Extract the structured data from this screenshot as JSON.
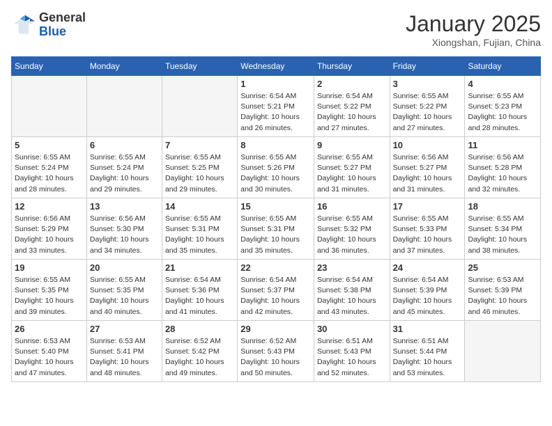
{
  "header": {
    "logo_general": "General",
    "logo_blue": "Blue",
    "month_title": "January 2025",
    "subtitle": "Xiongshan, Fujian, China"
  },
  "weekdays": [
    "Sunday",
    "Monday",
    "Tuesday",
    "Wednesday",
    "Thursday",
    "Friday",
    "Saturday"
  ],
  "weeks": [
    [
      {
        "day": "",
        "sunrise": "",
        "sunset": "",
        "daylight": "",
        "empty": true
      },
      {
        "day": "",
        "sunrise": "",
        "sunset": "",
        "daylight": "",
        "empty": true
      },
      {
        "day": "",
        "sunrise": "",
        "sunset": "",
        "daylight": "",
        "empty": true
      },
      {
        "day": "1",
        "sunrise": "Sunrise: 6:54 AM",
        "sunset": "Sunset: 5:21 PM",
        "daylight": "Daylight: 10 hours and 26 minutes."
      },
      {
        "day": "2",
        "sunrise": "Sunrise: 6:54 AM",
        "sunset": "Sunset: 5:22 PM",
        "daylight": "Daylight: 10 hours and 27 minutes."
      },
      {
        "day": "3",
        "sunrise": "Sunrise: 6:55 AM",
        "sunset": "Sunset: 5:22 PM",
        "daylight": "Daylight: 10 hours and 27 minutes."
      },
      {
        "day": "4",
        "sunrise": "Sunrise: 6:55 AM",
        "sunset": "Sunset: 5:23 PM",
        "daylight": "Daylight: 10 hours and 28 minutes."
      }
    ],
    [
      {
        "day": "5",
        "sunrise": "Sunrise: 6:55 AM",
        "sunset": "Sunset: 5:24 PM",
        "daylight": "Daylight: 10 hours and 28 minutes."
      },
      {
        "day": "6",
        "sunrise": "Sunrise: 6:55 AM",
        "sunset": "Sunset: 5:24 PM",
        "daylight": "Daylight: 10 hours and 29 minutes."
      },
      {
        "day": "7",
        "sunrise": "Sunrise: 6:55 AM",
        "sunset": "Sunset: 5:25 PM",
        "daylight": "Daylight: 10 hours and 29 minutes."
      },
      {
        "day": "8",
        "sunrise": "Sunrise: 6:55 AM",
        "sunset": "Sunset: 5:26 PM",
        "daylight": "Daylight: 10 hours and 30 minutes."
      },
      {
        "day": "9",
        "sunrise": "Sunrise: 6:55 AM",
        "sunset": "Sunset: 5:27 PM",
        "daylight": "Daylight: 10 hours and 31 minutes."
      },
      {
        "day": "10",
        "sunrise": "Sunrise: 6:56 AM",
        "sunset": "Sunset: 5:27 PM",
        "daylight": "Daylight: 10 hours and 31 minutes."
      },
      {
        "day": "11",
        "sunrise": "Sunrise: 6:56 AM",
        "sunset": "Sunset: 5:28 PM",
        "daylight": "Daylight: 10 hours and 32 minutes."
      }
    ],
    [
      {
        "day": "12",
        "sunrise": "Sunrise: 6:56 AM",
        "sunset": "Sunset: 5:29 PM",
        "daylight": "Daylight: 10 hours and 33 minutes."
      },
      {
        "day": "13",
        "sunrise": "Sunrise: 6:56 AM",
        "sunset": "Sunset: 5:30 PM",
        "daylight": "Daylight: 10 hours and 34 minutes."
      },
      {
        "day": "14",
        "sunrise": "Sunrise: 6:55 AM",
        "sunset": "Sunset: 5:31 PM",
        "daylight": "Daylight: 10 hours and 35 minutes."
      },
      {
        "day": "15",
        "sunrise": "Sunrise: 6:55 AM",
        "sunset": "Sunset: 5:31 PM",
        "daylight": "Daylight: 10 hours and 35 minutes."
      },
      {
        "day": "16",
        "sunrise": "Sunrise: 6:55 AM",
        "sunset": "Sunset: 5:32 PM",
        "daylight": "Daylight: 10 hours and 36 minutes."
      },
      {
        "day": "17",
        "sunrise": "Sunrise: 6:55 AM",
        "sunset": "Sunset: 5:33 PM",
        "daylight": "Daylight: 10 hours and 37 minutes."
      },
      {
        "day": "18",
        "sunrise": "Sunrise: 6:55 AM",
        "sunset": "Sunset: 5:34 PM",
        "daylight": "Daylight: 10 hours and 38 minutes."
      }
    ],
    [
      {
        "day": "19",
        "sunrise": "Sunrise: 6:55 AM",
        "sunset": "Sunset: 5:35 PM",
        "daylight": "Daylight: 10 hours and 39 minutes."
      },
      {
        "day": "20",
        "sunrise": "Sunrise: 6:55 AM",
        "sunset": "Sunset: 5:35 PM",
        "daylight": "Daylight: 10 hours and 40 minutes."
      },
      {
        "day": "21",
        "sunrise": "Sunrise: 6:54 AM",
        "sunset": "Sunset: 5:36 PM",
        "daylight": "Daylight: 10 hours and 41 minutes."
      },
      {
        "day": "22",
        "sunrise": "Sunrise: 6:54 AM",
        "sunset": "Sunset: 5:37 PM",
        "daylight": "Daylight: 10 hours and 42 minutes."
      },
      {
        "day": "23",
        "sunrise": "Sunrise: 6:54 AM",
        "sunset": "Sunset: 5:38 PM",
        "daylight": "Daylight: 10 hours and 43 minutes."
      },
      {
        "day": "24",
        "sunrise": "Sunrise: 6:54 AM",
        "sunset": "Sunset: 5:39 PM",
        "daylight": "Daylight: 10 hours and 45 minutes."
      },
      {
        "day": "25",
        "sunrise": "Sunrise: 6:53 AM",
        "sunset": "Sunset: 5:39 PM",
        "daylight": "Daylight: 10 hours and 46 minutes."
      }
    ],
    [
      {
        "day": "26",
        "sunrise": "Sunrise: 6:53 AM",
        "sunset": "Sunset: 5:40 PM",
        "daylight": "Daylight: 10 hours and 47 minutes."
      },
      {
        "day": "27",
        "sunrise": "Sunrise: 6:53 AM",
        "sunset": "Sunset: 5:41 PM",
        "daylight": "Daylight: 10 hours and 48 minutes."
      },
      {
        "day": "28",
        "sunrise": "Sunrise: 6:52 AM",
        "sunset": "Sunset: 5:42 PM",
        "daylight": "Daylight: 10 hours and 49 minutes."
      },
      {
        "day": "29",
        "sunrise": "Sunrise: 6:52 AM",
        "sunset": "Sunset: 5:43 PM",
        "daylight": "Daylight: 10 hours and 50 minutes."
      },
      {
        "day": "30",
        "sunrise": "Sunrise: 6:51 AM",
        "sunset": "Sunset: 5:43 PM",
        "daylight": "Daylight: 10 hours and 52 minutes."
      },
      {
        "day": "31",
        "sunrise": "Sunrise: 6:51 AM",
        "sunset": "Sunset: 5:44 PM",
        "daylight": "Daylight: 10 hours and 53 minutes."
      },
      {
        "day": "",
        "sunrise": "",
        "sunset": "",
        "daylight": "",
        "empty": true
      }
    ]
  ]
}
